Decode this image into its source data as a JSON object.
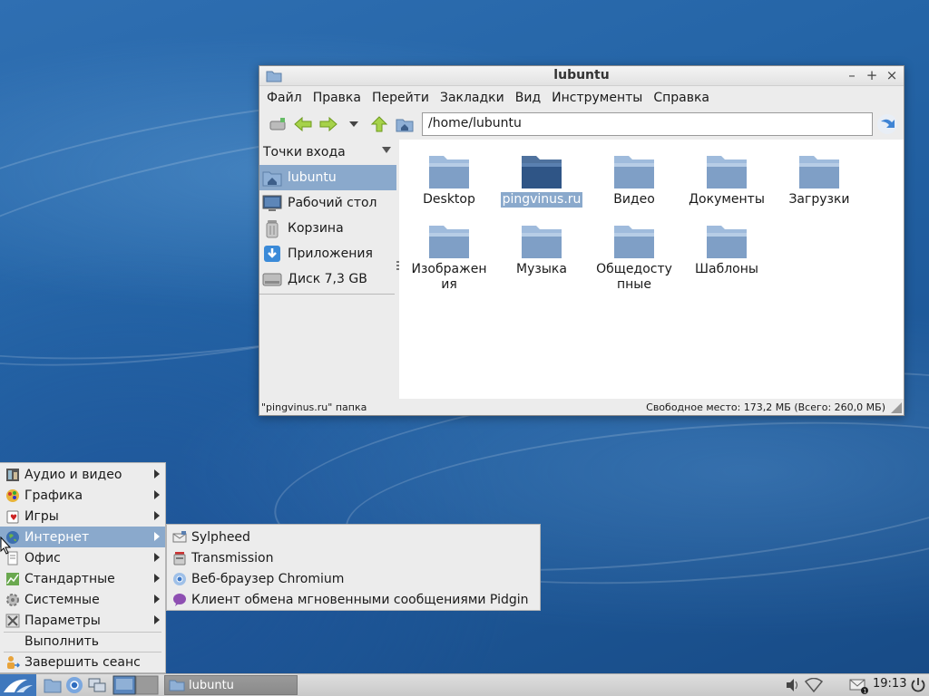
{
  "window": {
    "title": "lubuntu",
    "menu": [
      "Файл",
      "Правка",
      "Перейти",
      "Закладки",
      "Вид",
      "Инструменты",
      "Справка"
    ],
    "path": "/home/lubuntu",
    "sidebar": {
      "header": "Точки входа",
      "items": [
        {
          "label": "lubuntu",
          "icon": "home-folder-icon",
          "selected": true
        },
        {
          "label": "Рабочий стол",
          "icon": "desktop-icon"
        },
        {
          "label": "Корзина",
          "icon": "trash-icon"
        },
        {
          "label": "Приложения",
          "icon": "applications-icon"
        },
        {
          "label": "Диск 7,3 GB",
          "icon": "drive-icon"
        }
      ]
    },
    "files": [
      {
        "label": "Desktop"
      },
      {
        "label": "pingvinus.ru",
        "selected": true
      },
      {
        "label": "Видео"
      },
      {
        "label": "Документы"
      },
      {
        "label": "Загрузки"
      },
      {
        "label": "Изображения"
      },
      {
        "label": "Музыка"
      },
      {
        "label": "Общедоступные"
      },
      {
        "label": "Шаблоны"
      }
    ],
    "status_left": "\"pingvinus.ru\" папка",
    "status_right": "Свободное место: 173,2 МБ (Всего: 260,0 МБ)"
  },
  "start_menu": {
    "items": [
      {
        "label": "Аудио и видео",
        "icon": "audio-video-icon",
        "submenu": true
      },
      {
        "label": "Графика",
        "icon": "graphics-icon",
        "submenu": true
      },
      {
        "label": "Игры",
        "icon": "games-icon",
        "submenu": true
      },
      {
        "label": "Интернет",
        "icon": "internet-icon",
        "submenu": true,
        "highlighted": true
      },
      {
        "label": "Офис",
        "icon": "office-icon",
        "submenu": true
      },
      {
        "label": "Стандартные",
        "icon": "accessories-icon",
        "submenu": true
      },
      {
        "label": "Системные",
        "icon": "system-icon",
        "submenu": true
      },
      {
        "label": "Параметры",
        "icon": "preferences-icon",
        "submenu": true
      },
      {
        "label": "Выполнить",
        "icon": "",
        "submenu": false
      },
      {
        "label": "Завершить сеанс",
        "icon": "logout-icon",
        "submenu": false
      }
    ],
    "internet_submenu": [
      {
        "label": "Sylpheed",
        "icon": "mail-icon"
      },
      {
        "label": "Transmission",
        "icon": "torrent-icon"
      },
      {
        "label": "Веб-браузер Chromium",
        "icon": "chromium-icon"
      },
      {
        "label": "Клиент обмена мгновенными сообщениями Pidgin",
        "icon": "pidgin-icon"
      }
    ]
  },
  "panel": {
    "task_label": "lubuntu",
    "clock": "19:13"
  },
  "colors": {
    "selection": "#8aa9cc",
    "desktop": "#2464a6",
    "folder": "#7f9fc6"
  }
}
